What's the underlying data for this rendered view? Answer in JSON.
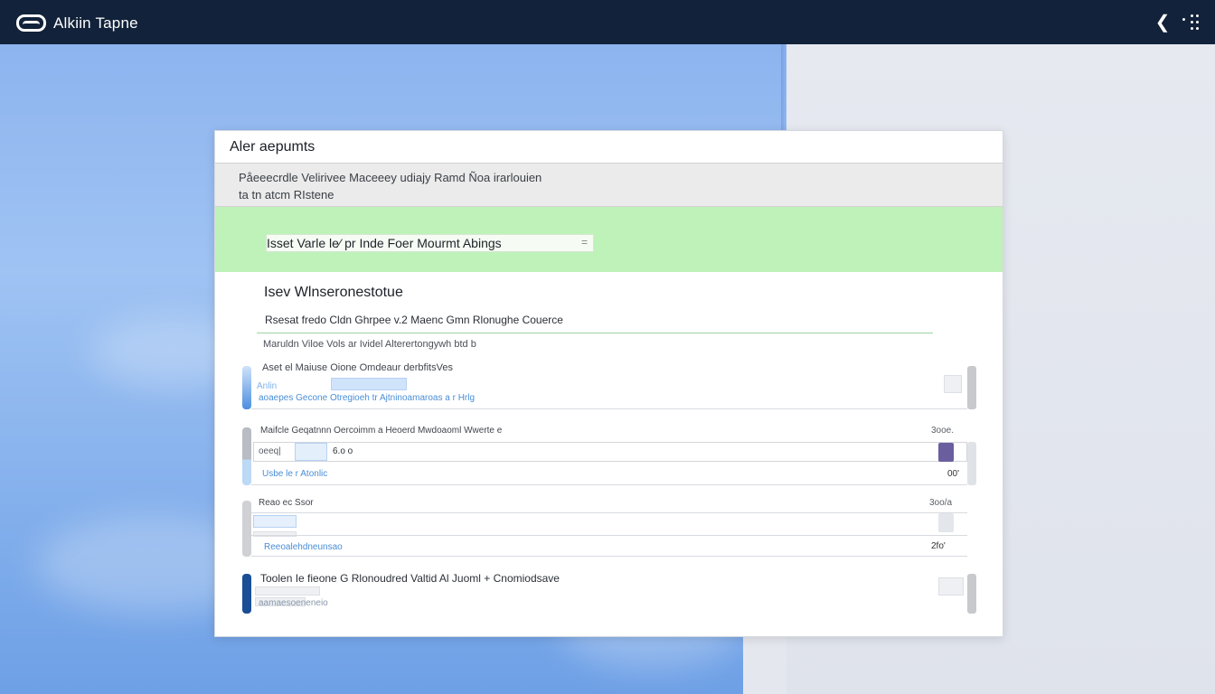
{
  "app": {
    "title": "Alkiin Tapne"
  },
  "panel": {
    "title": "Aler aepumts",
    "description_line1": "Påeeecrdle Velirivee Maceeey udiajy Ramd Ñoa irarlouien",
    "description_line2": "ta tn atcm RIstene",
    "banner_text": "Isset Varle le⁄  pr Inde  Foer  Mourmt  Abings",
    "banner_close": "=",
    "section_title": "Isev Wlnseronestotue",
    "sub_heading": "Rsesat fredo  Cldn Ghrpee v.2 Maenc Gmn Rlonughe Couerce",
    "note": "Maruldn Viloe  Vols ar Ividel Alterertongywh btd b",
    "rows": [
      {
        "title": "Aset  el Maiuse Oione Omdeaur derbfitsVes",
        "chip_label": "Anlin",
        "link": "aoaepes Gecone Otregioeh tr Ajtninoamaroas a r Hrlg",
        "bar_color": "#4c8ee0",
        "swatch_color": "#dfe4ea"
      },
      {
        "title": "Maifcle Geqatnnn Oercoimm  a  Heoerd Mwdoaoml Wwerte e",
        "count": "3ooe.",
        "input_label": "oeeq|",
        "input_value": "6.o o",
        "link": "Usbe  le r Atonlic",
        "value": "00'",
        "bar_color": "#b9bcc2",
        "swatch_color": "#6a5e9e"
      },
      {
        "title": "Reao ec  Ssor",
        "count": "3oo/a",
        "link": "Reeoalehdneunsao",
        "value": "2fo'",
        "bar_color": "#cfd1d5",
        "swatch_color": "#d9dce1"
      },
      {
        "title": "Toolen Ie  fieone  G Rlonoudred  Valtid Al Juoml + Cnomiodsave",
        "link": "aamaesoeneneio",
        "bar_color": "#1a4e95",
        "swatch_color": "#d7dbe2"
      }
    ]
  }
}
